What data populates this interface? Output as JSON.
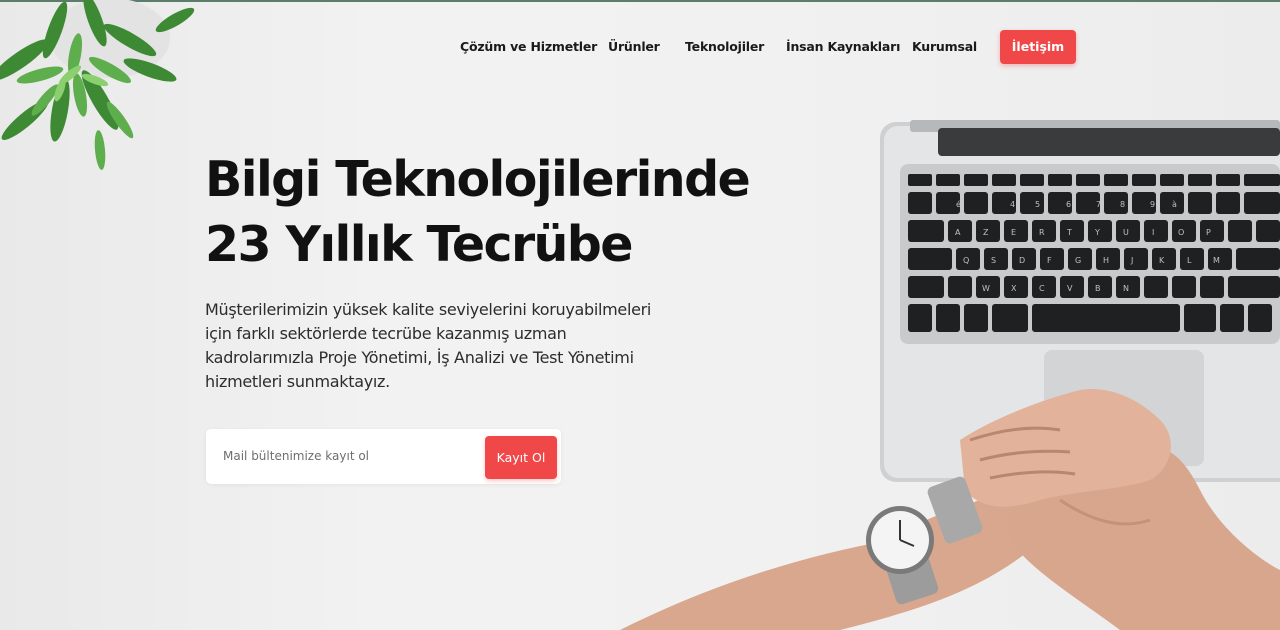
{
  "nav": {
    "items": [
      {
        "label": "Çözüm ve Hizmetler"
      },
      {
        "label": "Ürünler"
      },
      {
        "label": "Teknolojiler"
      },
      {
        "label": "İnsan Kaynakları"
      },
      {
        "label": "Kurumsal"
      }
    ],
    "cta_label": "İletişim"
  },
  "hero": {
    "title_lines": [
      "Bilgi Teknolojilerinde",
      "23 Yıllık Tecrübe"
    ],
    "description_lines": [
      "Müşterilerimizin yüksek kalite seviyelerini koruyabilmeleri",
      "için farklı sektörlerde tecrübe kazanmış uzman",
      "kadrolarımızla Proje Yönetimi, İş Analizi ve Test Yönetimi",
      "hizmetleri sunmaktayız."
    ]
  },
  "newsletter": {
    "placeholder": "Mail bültenimize kayıt ol",
    "value": "",
    "button_label": "Kayıt Ol"
  },
  "colors": {
    "accent": "#f04848",
    "text": "#111111",
    "background": "#f1f1f1"
  },
  "images": {
    "plant": "potted-plant",
    "laptop": "laptop-keyboard",
    "hands": "clasped-hands-with-wristwatch"
  }
}
